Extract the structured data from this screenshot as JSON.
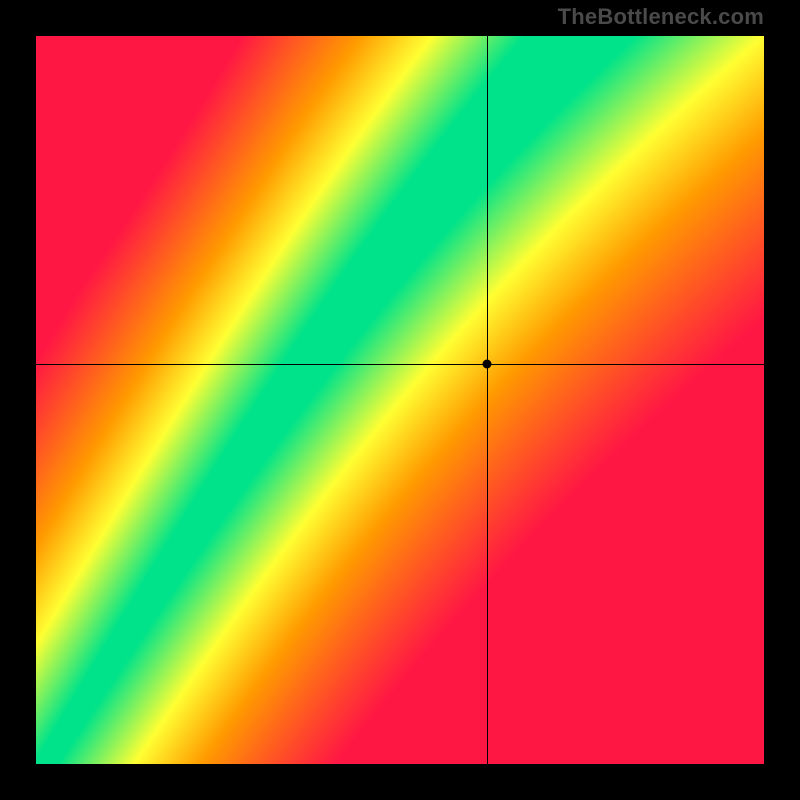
{
  "watermark": "TheBottleneck.com",
  "chart_data": {
    "type": "heatmap",
    "title": "",
    "xlabel": "",
    "ylabel": "",
    "xlim": [
      0,
      1
    ],
    "ylim": [
      0,
      1
    ],
    "crosshair": {
      "x": 0.62,
      "y": 0.55
    },
    "marker": {
      "x": 0.62,
      "y": 0.55
    },
    "color_scale": [
      {
        "value": 0.0,
        "color": "#ff1744"
      },
      {
        "value": 0.45,
        "color": "#ff9b00"
      },
      {
        "value": 0.7,
        "color": "#ffff33"
      },
      {
        "value": 1.0,
        "color": "#00e38a"
      }
    ],
    "optimal_band": {
      "description": "Green diagonal band indicating balanced configuration; steeper than 45 degrees with slight S-curve.",
      "points_lower": [
        [
          0.02,
          0.0
        ],
        [
          0.18,
          0.22
        ],
        [
          0.36,
          0.44
        ],
        [
          0.5,
          0.58
        ],
        [
          0.66,
          0.76
        ],
        [
          0.8,
          0.9
        ],
        [
          0.9,
          1.0
        ]
      ],
      "points_upper": [
        [
          0.0,
          0.02
        ],
        [
          0.12,
          0.26
        ],
        [
          0.28,
          0.48
        ],
        [
          0.44,
          0.64
        ],
        [
          0.58,
          0.8
        ],
        [
          0.72,
          0.94
        ],
        [
          0.8,
          1.0
        ]
      ]
    }
  }
}
